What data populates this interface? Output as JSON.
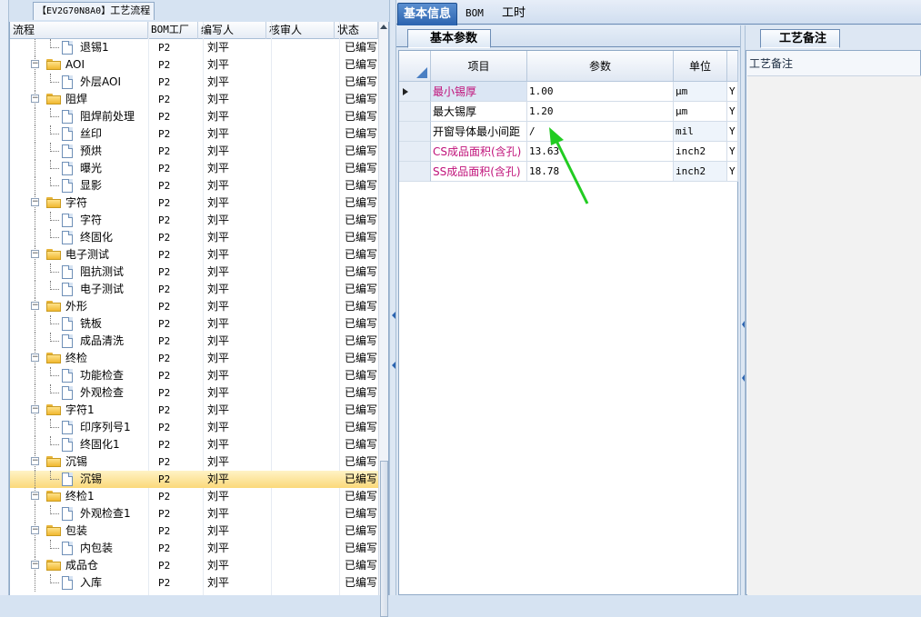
{
  "left_panel": {
    "title_code": "【EV2G70N8A0】",
    "title_text": "工艺流程",
    "columns": [
      "流程",
      "BOM工厂",
      "编写人",
      "核审人",
      "状态"
    ]
  },
  "tree_rows": [
    {
      "name": "退锡1",
      "type": "doc",
      "level": 2,
      "bom": "P2",
      "writer": "刘平",
      "reviewer": "",
      "status": "已编写"
    },
    {
      "name": "AOI",
      "type": "folder",
      "level": 1,
      "bom": "P2",
      "writer": "刘平",
      "reviewer": "",
      "status": "已编写"
    },
    {
      "name": "外层AOI",
      "type": "doc",
      "level": 2,
      "bom": "P2",
      "writer": "刘平",
      "reviewer": "",
      "status": "已编写"
    },
    {
      "name": "阻焊",
      "type": "folder",
      "level": 1,
      "bom": "P2",
      "writer": "刘平",
      "reviewer": "",
      "status": "已编写"
    },
    {
      "name": "阻焊前处理",
      "type": "doc",
      "level": 2,
      "bom": "P2",
      "writer": "刘平",
      "reviewer": "",
      "status": "已编写"
    },
    {
      "name": "丝印",
      "type": "doc",
      "level": 2,
      "bom": "P2",
      "writer": "刘平",
      "reviewer": "",
      "status": "已编写"
    },
    {
      "name": "预烘",
      "type": "doc",
      "level": 2,
      "bom": "P2",
      "writer": "刘平",
      "reviewer": "",
      "status": "已编写"
    },
    {
      "name": "曝光",
      "type": "doc",
      "level": 2,
      "bom": "P2",
      "writer": "刘平",
      "reviewer": "",
      "status": "已编写"
    },
    {
      "name": "显影",
      "type": "doc",
      "level": 2,
      "bom": "P2",
      "writer": "刘平",
      "reviewer": "",
      "status": "已编写"
    },
    {
      "name": "字符",
      "type": "folder",
      "level": 1,
      "bom": "P2",
      "writer": "刘平",
      "reviewer": "",
      "status": "已编写"
    },
    {
      "name": "字符",
      "type": "doc",
      "level": 2,
      "bom": "P2",
      "writer": "刘平",
      "reviewer": "",
      "status": "已编写"
    },
    {
      "name": "终固化",
      "type": "doc",
      "level": 2,
      "bom": "P2",
      "writer": "刘平",
      "reviewer": "",
      "status": "已编写"
    },
    {
      "name": "电子测试",
      "type": "folder",
      "level": 1,
      "bom": "P2",
      "writer": "刘平",
      "reviewer": "",
      "status": "已编写"
    },
    {
      "name": "阻抗测试",
      "type": "doc",
      "level": 2,
      "bom": "P2",
      "writer": "刘平",
      "reviewer": "",
      "status": "已编写"
    },
    {
      "name": "电子测试",
      "type": "doc",
      "level": 2,
      "bom": "P2",
      "writer": "刘平",
      "reviewer": "",
      "status": "已编写"
    },
    {
      "name": "外形",
      "type": "folder",
      "level": 1,
      "bom": "P2",
      "writer": "刘平",
      "reviewer": "",
      "status": "已编写"
    },
    {
      "name": "铣板",
      "type": "doc",
      "level": 2,
      "bom": "P2",
      "writer": "刘平",
      "reviewer": "",
      "status": "已编写"
    },
    {
      "name": "成品清洗",
      "type": "doc",
      "level": 2,
      "bom": "P2",
      "writer": "刘平",
      "reviewer": "",
      "status": "已编写"
    },
    {
      "name": "终检",
      "type": "folder",
      "level": 1,
      "bom": "P2",
      "writer": "刘平",
      "reviewer": "",
      "status": "已编写"
    },
    {
      "name": "功能检查",
      "type": "doc",
      "level": 2,
      "bom": "P2",
      "writer": "刘平",
      "reviewer": "",
      "status": "已编写"
    },
    {
      "name": "外观检查",
      "type": "doc",
      "level": 2,
      "bom": "P2",
      "writer": "刘平",
      "reviewer": "",
      "status": "已编写"
    },
    {
      "name": "字符1",
      "type": "folder",
      "level": 1,
      "bom": "P2",
      "writer": "刘平",
      "reviewer": "",
      "status": "已编写"
    },
    {
      "name": "印序列号1",
      "type": "doc",
      "level": 2,
      "bom": "P2",
      "writer": "刘平",
      "reviewer": "",
      "status": "已编写"
    },
    {
      "name": "终固化1",
      "type": "doc",
      "level": 2,
      "bom": "P2",
      "writer": "刘平",
      "reviewer": "",
      "status": "已编写"
    },
    {
      "name": "沉锡",
      "type": "folder",
      "level": 1,
      "bom": "P2",
      "writer": "刘平",
      "reviewer": "",
      "status": "已编写"
    },
    {
      "name": "沉锡",
      "type": "doc",
      "level": 2,
      "bom": "P2",
      "writer": "刘平",
      "reviewer": "",
      "status": "已编写",
      "selected": true
    },
    {
      "name": "终检1",
      "type": "folder",
      "level": 1,
      "bom": "P2",
      "writer": "刘平",
      "reviewer": "",
      "status": "已编写"
    },
    {
      "name": "外观检查1",
      "type": "doc",
      "level": 2,
      "bom": "P2",
      "writer": "刘平",
      "reviewer": "",
      "status": "已编写"
    },
    {
      "name": "包装",
      "type": "folder",
      "level": 1,
      "bom": "P2",
      "writer": "刘平",
      "reviewer": "",
      "status": "已编写"
    },
    {
      "name": "内包装",
      "type": "doc",
      "level": 2,
      "bom": "P2",
      "writer": "刘平",
      "reviewer": "",
      "status": "已编写"
    },
    {
      "name": "成品仓",
      "type": "folder",
      "level": 1,
      "bom": "P2",
      "writer": "刘平",
      "reviewer": "",
      "status": "已编写"
    },
    {
      "name": "入库",
      "type": "doc",
      "level": 2,
      "bom": "P2",
      "writer": "刘平",
      "reviewer": "",
      "status": "已编写"
    }
  ],
  "top_tabs": [
    {
      "label": "基本信息",
      "active": true
    },
    {
      "label": "BOM",
      "active": false
    },
    {
      "label": "工时",
      "active": false
    }
  ],
  "params": {
    "tab_label": "基本参数",
    "columns": [
      "项目",
      "参数",
      "单位"
    ],
    "rows": [
      {
        "item": "最小锡厚",
        "value": "1.00",
        "unit": "μm",
        "extra": "Y",
        "highlight": true,
        "current": true
      },
      {
        "item": "最大锡厚",
        "value": "1.20",
        "unit": "μm",
        "extra": "Y",
        "highlight": false
      },
      {
        "item": "开窗导体最小间距",
        "value": "/",
        "unit": "mil",
        "extra": "Y",
        "highlight": false
      },
      {
        "item": "CS成品面积(含孔)",
        "value": "13.63",
        "unit": "inch2",
        "extra": "Y",
        "highlight": true
      },
      {
        "item": "SS成品面积(含孔)",
        "value": "18.78",
        "unit": "inch2",
        "extra": "Y",
        "highlight": true
      }
    ]
  },
  "notes": {
    "tab_label": "工艺备注",
    "label": "工艺备注"
  },
  "colors": {
    "accent": "#2c64b0",
    "highlight_text": "#c0127a",
    "annotation_arrow": "#22cc22",
    "selected_row": "#fbd97a"
  }
}
